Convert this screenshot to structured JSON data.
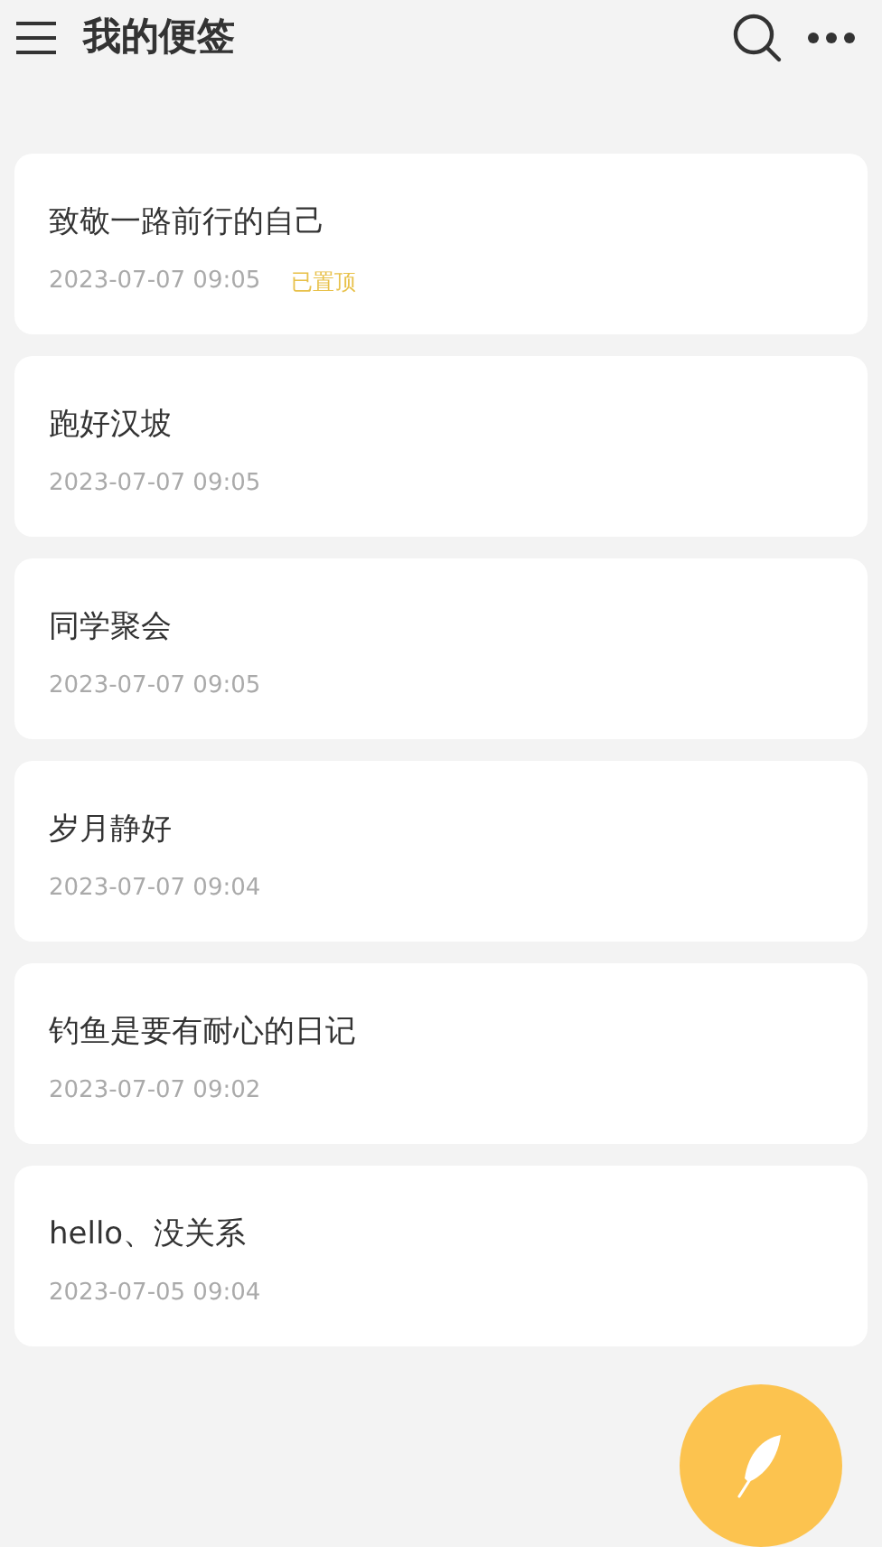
{
  "header": {
    "title": "我的便签"
  },
  "pinned_label": "已置顶",
  "notes": [
    {
      "title": "致敬一路前行的自己",
      "time": "2023-07-07 09:05",
      "pinned": true
    },
    {
      "title": "跑好汉坡",
      "time": "2023-07-07 09:05",
      "pinned": false
    },
    {
      "title": "同学聚会",
      "time": "2023-07-07 09:05",
      "pinned": false
    },
    {
      "title": "岁月静好",
      "time": "2023-07-07 09:04",
      "pinned": false
    },
    {
      "title": "钓鱼是要有耐心的日记",
      "time": "2023-07-07 09:02",
      "pinned": false
    },
    {
      "title": "hello、没关系",
      "time": "2023-07-05 09:04",
      "pinned": false
    }
  ]
}
